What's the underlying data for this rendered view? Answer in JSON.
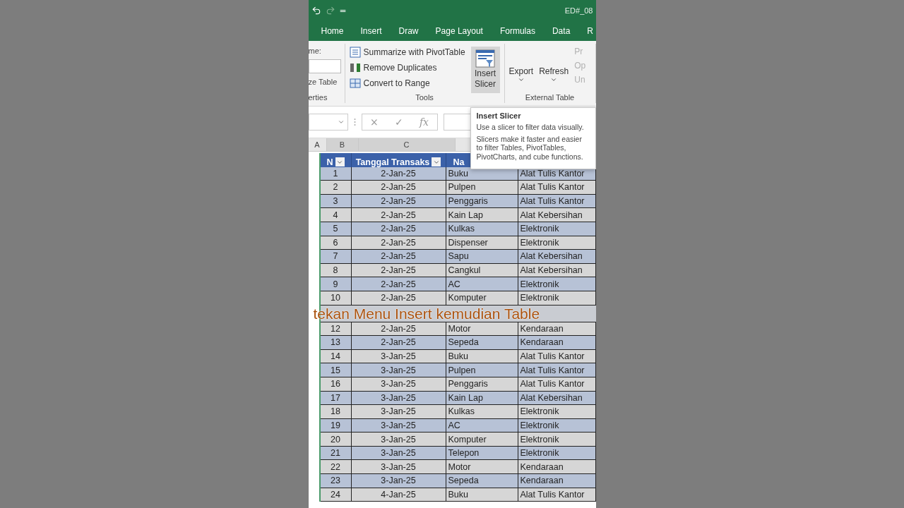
{
  "title_bar": {
    "quick_access": "=",
    "title": "ED#_08"
  },
  "tabs": [
    {
      "label": "Home",
      "selected": false
    },
    {
      "label": "Insert",
      "selected": false
    },
    {
      "label": "Draw",
      "selected": false
    },
    {
      "label": "Page Layout",
      "selected": false
    },
    {
      "label": "Formulas",
      "selected": false
    },
    {
      "label": "Data",
      "selected": false
    },
    {
      "label": "R",
      "selected": false
    }
  ],
  "ribbon": {
    "properties": {
      "name_label": "me:",
      "resize": "ze Table",
      "group_label": "erties"
    },
    "tools": {
      "items": [
        "Summarize with PivotTable",
        "Remove Duplicates",
        "Convert to Range"
      ],
      "slicer": {
        "label": "Insert Slicer",
        "hovered": true
      },
      "group_label": "Tools"
    },
    "external": {
      "buttons": [
        "Export",
        "Refresh"
      ],
      "disabled_items": [
        "Pr",
        "Op",
        "Un"
      ],
      "group_label": "External Table"
    }
  },
  "formula_bar": {
    "cancel": "×",
    "enter": "✓",
    "fx": "fx"
  },
  "column_headers": [
    "A",
    "B",
    "C"
  ],
  "table": {
    "headers": [
      "N",
      "Tanggal Transaks",
      "Na"
    ],
    "rows_above_caption": [
      [
        "1",
        "2-Jan-25",
        "Buku",
        "Alat Tulis Kantor"
      ],
      [
        "2",
        "2-Jan-25",
        "Pulpen",
        "Alat Tulis Kantor"
      ],
      [
        "3",
        "2-Jan-25",
        "Penggaris",
        "Alat Tulis Kantor"
      ],
      [
        "4",
        "2-Jan-25",
        "Kain Lap",
        "Alat Kebersihan"
      ],
      [
        "5",
        "2-Jan-25",
        "Kulkas",
        "Elektronik"
      ],
      [
        "6",
        "2-Jan-25",
        "Dispenser",
        "Elektronik"
      ],
      [
        "7",
        "2-Jan-25",
        "Sapu",
        "Alat Kebersihan"
      ],
      [
        "8",
        "2-Jan-25",
        "Cangkul",
        "Alat Kebersihan"
      ],
      [
        "9",
        "2-Jan-25",
        "AC",
        "Elektronik"
      ],
      [
        "10",
        "2-Jan-25",
        "Komputer",
        "Elektronik"
      ]
    ],
    "caption": "tekan Menu Insert kemudian Table",
    "rows_below_caption": [
      [
        "12",
        "2-Jan-25",
        "Motor",
        "Kendaraan"
      ],
      [
        "13",
        "2-Jan-25",
        "Sepeda",
        "Kendaraan"
      ],
      [
        "14",
        "3-Jan-25",
        "Buku",
        "Alat Tulis Kantor"
      ],
      [
        "15",
        "3-Jan-25",
        "Pulpen",
        "Alat Tulis Kantor"
      ],
      [
        "16",
        "3-Jan-25",
        "Penggaris",
        "Alat Tulis Kantor"
      ],
      [
        "17",
        "3-Jan-25",
        "Kain Lap",
        "Alat Kebersihan"
      ],
      [
        "18",
        "3-Jan-25",
        "Kulkas",
        "Elektronik"
      ],
      [
        "19",
        "3-Jan-25",
        "AC",
        "Elektronik"
      ],
      [
        "20",
        "3-Jan-25",
        "Komputer",
        "Elektronik"
      ],
      [
        "21",
        "3-Jan-25",
        "Telepon",
        "Elektronik"
      ],
      [
        "22",
        "3-Jan-25",
        "Motor",
        "Kendaraan"
      ],
      [
        "23",
        "3-Jan-25",
        "Sepeda",
        "Kendaraan"
      ],
      [
        "24",
        "4-Jan-25",
        "Buku",
        "Alat Tulis Kantor"
      ]
    ]
  },
  "tooltip": {
    "title": "Insert Slicer",
    "lines": [
      "Use a slicer to filter data visually.",
      "Slicers make it faster and easier to filter Tables, PivotTables, PivotCharts, and cube functions."
    ]
  }
}
